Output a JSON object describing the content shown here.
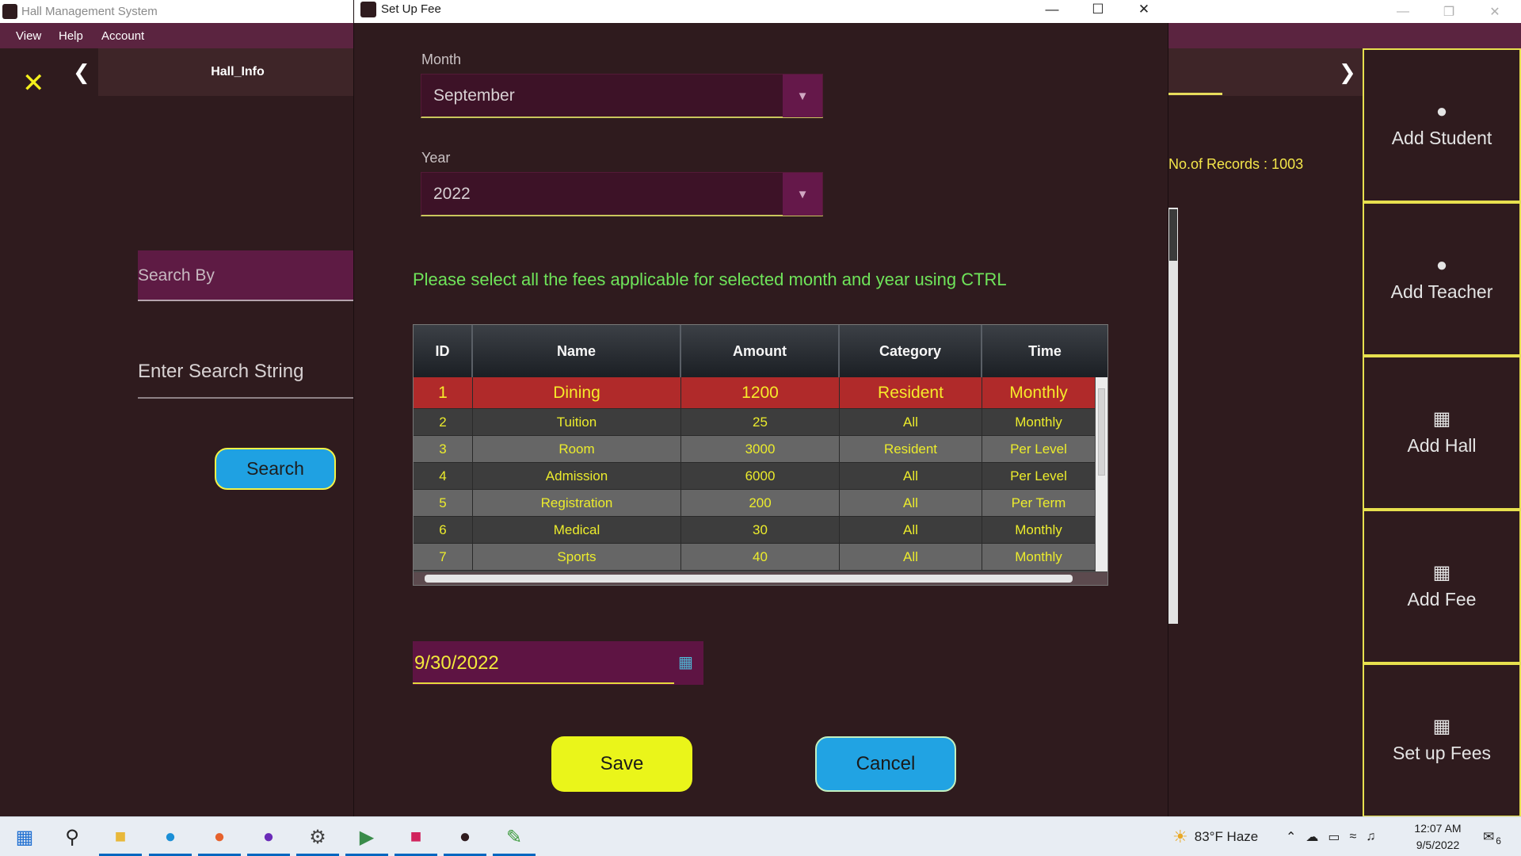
{
  "app": {
    "title": "Hall Management System",
    "menu": [
      "View",
      "Help",
      "Account"
    ],
    "tab_title": "Hall_Info",
    "search_by_placeholder": "Search By",
    "search_string_placeholder": "Enter Search String",
    "search_button": "Search",
    "records_label": "No.of Records : 1003",
    "side_buttons": [
      {
        "label": "Add Student",
        "icon": "user-icon"
      },
      {
        "label": "Add Teacher",
        "icon": "user-icon"
      },
      {
        "label": "Add Hall",
        "icon": "table-icon"
      },
      {
        "label": "Add Fee",
        "icon": "table-icon"
      },
      {
        "label": "Set up Fees",
        "icon": "table-icon"
      }
    ]
  },
  "dialog": {
    "title": "Set Up Fee",
    "month_label": "Month",
    "month_value": "September",
    "year_label": "Year",
    "year_value": "2022",
    "instruction": "Please select all the fees applicable for selected month and year using CTRL",
    "columns": [
      "ID",
      "Name",
      "Amount",
      "Category",
      "Time"
    ],
    "rows": [
      {
        "id": "1",
        "name": "Dining",
        "amount": "1200",
        "category": "Resident",
        "time": "Monthly",
        "selected": true
      },
      {
        "id": "2",
        "name": "Tuition",
        "amount": "25",
        "category": "All",
        "time": "Monthly"
      },
      {
        "id": "3",
        "name": "Room",
        "amount": "3000",
        "category": "Resident",
        "time": "Per Level"
      },
      {
        "id": "4",
        "name": "Admission",
        "amount": "6000",
        "category": "All",
        "time": "Per Level"
      },
      {
        "id": "5",
        "name": "Registration",
        "amount": "200",
        "category": "All",
        "time": "Per Term"
      },
      {
        "id": "6",
        "name": "Medical",
        "amount": "30",
        "category": "All",
        "time": "Monthly"
      },
      {
        "id": "7",
        "name": "Sports",
        "amount": "40",
        "category": "All",
        "time": "Monthly"
      }
    ],
    "date_value": "9/30/2022",
    "save_label": "Save",
    "cancel_label": "Cancel"
  },
  "taskbar": {
    "weather": "83°F  Haze",
    "time": "12:07 AM",
    "date": "9/5/2022",
    "notifications": "6"
  },
  "colors": {
    "background": "#2f1b1e",
    "accent_yellow": "#eaf51a",
    "accent_blue": "#21a3e3",
    "selected_row": "#b02a2a",
    "instruction_green": "#6fe45a"
  }
}
